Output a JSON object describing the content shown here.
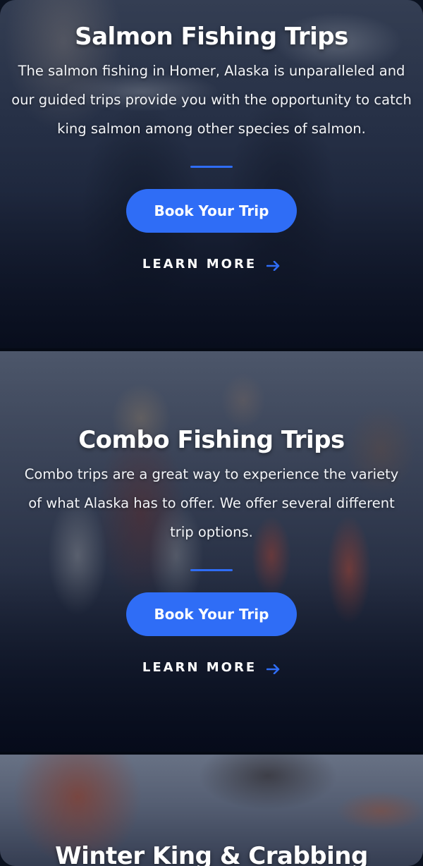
{
  "cards": [
    {
      "title": "Salmon Fishing Trips",
      "description": "The salmon fishing in Homer, Alaska is unparalleled and our guided trips provide you with the opportunity to catch king salmon among other species of salmon.",
      "button_label": "Book Your Trip",
      "link_label": "LEARN MORE",
      "link_icon": "arrow-right-icon"
    },
    {
      "title": "Combo Fishing Trips",
      "description": "Combo trips are a great way to experience the variety of what Alaska has to offer. We offer several different trip options.",
      "button_label": "Book Your Trip",
      "link_label": "LEARN MORE",
      "link_icon": "arrow-right-icon"
    },
    {
      "title": "Winter King & Crabbing"
    }
  ],
  "colors": {
    "accent": "#2f6df6",
    "overlay": "#0b1530",
    "text": "#ffffff"
  }
}
